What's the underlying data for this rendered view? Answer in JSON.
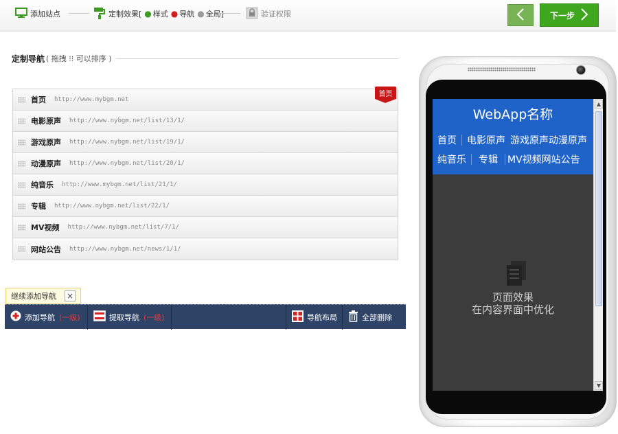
{
  "wizard": {
    "step1_label": "添加站点",
    "step2_label": "定制效果[",
    "step2_opt_style": "样式",
    "step2_opt_nav": "导航",
    "step2_opt_global": "全局]",
    "step3_label": "验证权限",
    "next_label": "下一步"
  },
  "section": {
    "title": "定制导航",
    "hint": "( 拖拽 ⁝⁝ 可以排序 )"
  },
  "nav_items": [
    {
      "name": "首页",
      "url": "http://www.mybgm.net"
    },
    {
      "name": "电影原声",
      "url": "http://www.nybgm.net/list/13/1/"
    },
    {
      "name": "游戏原声",
      "url": "http://www.nybgm.net/list/19/1/"
    },
    {
      "name": "动漫原声",
      "url": "http://www.nybgm.net/list/20/1/"
    },
    {
      "name": "纯音乐",
      "url": "http://www.mybgm.net/list/21/1/"
    },
    {
      "name": "专辑",
      "url": "http://www.nybgm.net/list/22/1/"
    },
    {
      "name": "MV视频",
      "url": "http://www.nybgm.net/list/7/1/"
    },
    {
      "name": "网站公告",
      "url": "http://www.nybgm.net/news/1/1/"
    }
  ],
  "home_tag": "首页",
  "tooltip": {
    "text": "继续添加导航",
    "close": "×"
  },
  "toolbar": {
    "add_nav": "添加导航",
    "add_nav_level": "(一级)",
    "fetch_nav": "提取导航",
    "fetch_nav_level": "(一级)",
    "layout": "导航布局",
    "delete_all": "全部删除"
  },
  "phone": {
    "app_title": "WebApp名称",
    "nav_row1": [
      "首页",
      "电影原声",
      "游戏原声",
      "动漫原声"
    ],
    "nav_row2": [
      "纯音乐",
      "专辑",
      "MV视频",
      "网站公告"
    ],
    "placeholder_line1": "页面效果",
    "placeholder_line2": "在内容界面中优化"
  },
  "colors": {
    "accent_green": "#3ea71d",
    "app_blue": "#1f62c8",
    "toolbar_navy": "#2f4366",
    "home_red": "#c81515"
  }
}
